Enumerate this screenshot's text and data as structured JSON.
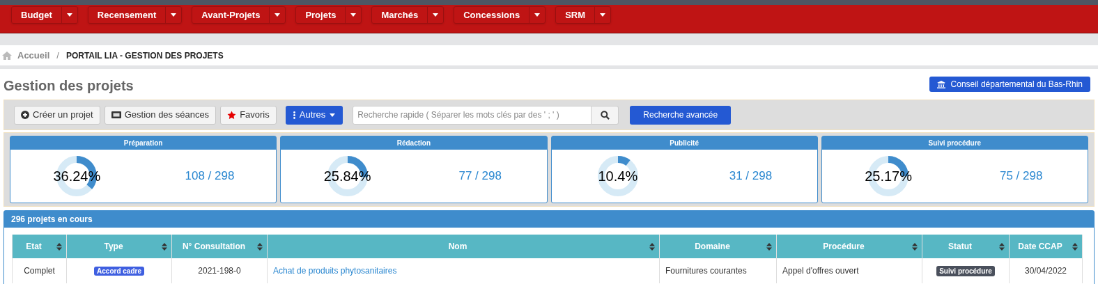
{
  "menu": [
    {
      "label": "Budget"
    },
    {
      "label": "Recensement"
    },
    {
      "label": "Avant-Projets"
    },
    {
      "label": "Projets"
    },
    {
      "label": "Marchés"
    },
    {
      "label": "Concessions"
    },
    {
      "label": "SRM"
    }
  ],
  "breadcrumb": {
    "home": "Accueil",
    "separator": "/",
    "current": "PORTAIL LIA - GESTION DES PROJETS"
  },
  "page_title": "Gestion des projets",
  "organization_button": "Conseil départemental du Bas-Rhin",
  "toolbar": {
    "buttons": [
      {
        "label": "Créer un projet",
        "kind": "create"
      },
      {
        "label": "Gestion des séances",
        "kind": "sessions"
      },
      {
        "label": "Favoris",
        "kind": "favorites"
      }
    ],
    "others_button": "Autres",
    "search": {
      "placeholder": "Recherche rapide ( Séparer les mots clés par des ' ; ' )"
    },
    "advanced_search": "Recherche avancée"
  },
  "stats": [
    {
      "title": "Préparation",
      "percent": "36.24%",
      "count": "108 / 298"
    },
    {
      "title": "Rédaction",
      "percent": "25.84%",
      "count": "77 / 298"
    },
    {
      "title": "Publicité",
      "percent": "10.4%",
      "count": "31 / 298"
    },
    {
      "title": "Suivi procédure",
      "percent": "25.17%",
      "count": "75 / 298"
    }
  ],
  "projects": {
    "title": "296 projets en cours",
    "columns": [
      "Etat",
      "Type",
      "N° Consultation",
      "Nom",
      "Domaine",
      "Procédure",
      "Statut",
      "Date CCAP"
    ],
    "rows": [
      {
        "etat": "Complet",
        "type": {
          "label": "Accord cadre",
          "color": "#3f5fe0"
        },
        "consultation": "2021-198-0",
        "nom": "Achat de produits phytosanitaires",
        "domaine": "Fournitures courantes",
        "procedure": "Appel d'offres ouvert",
        "statut": {
          "label": "Suivi procédure",
          "color": "#4a505c"
        },
        "date": "30/04/2022"
      }
    ]
  }
}
